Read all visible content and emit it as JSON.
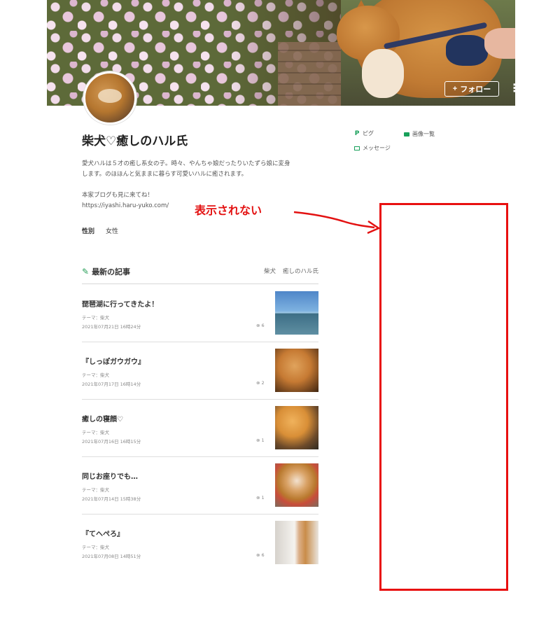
{
  "profile": {
    "title": "柴犬♡癒しのハル氏",
    "desc_lines": [
      "愛犬ハルは５才の癒し系女の子。時々、やんちゃ娘だったりいたずら娘に変身",
      "します。のほほんと気ままに暮らす可愛いハルに癒されます。",
      "本家ブログも見に来てね！",
      "https://iyashi.haru-yuko.com/"
    ],
    "gender_label": "性別",
    "gender_value": "女性"
  },
  "header": {
    "follow_label": "フォロー",
    "follow_plus": "+",
    "more_label": "⋮"
  },
  "sidebar": {
    "pigg": "ピグ",
    "images": "画像一覧",
    "message": "メッセージ"
  },
  "annotation": {
    "text": "表示されない",
    "color": "#e81010"
  },
  "posts": {
    "title": "最新の記事",
    "tags": [
      "柴犬",
      "癒しのハル氏"
    ],
    "items": [
      {
        "title": "琵琶湖に行ってきたよ！",
        "theme": "テーマ：柴犬",
        "date": "2021年07月21日 16時24分",
        "likes": "6",
        "thumb": "sea"
      },
      {
        "title": "『しっぽガウガウ』",
        "theme": "テーマ：柴犬",
        "date": "2021年07月17日 16時14分",
        "likes": "2",
        "thumb": "dog1"
      },
      {
        "title": "癒しの寝顔♡",
        "theme": "テーマ：柴犬",
        "date": "2021年07月16日 16時15分",
        "likes": "1",
        "thumb": "dog2"
      },
      {
        "title": "同じお座りでも…",
        "theme": "テーマ：柴犬",
        "date": "2021年07月14日 15時38分",
        "likes": "1",
        "thumb": "dog3"
      },
      {
        "title": "『てへぺろ』",
        "theme": "テーマ：柴犬",
        "date": "2021年07月08日 14時51分",
        "likes": "6",
        "thumb": "dog4"
      }
    ]
  },
  "colors": {
    "accent_green": "#18a05a",
    "annotation_red": "#e81010"
  }
}
